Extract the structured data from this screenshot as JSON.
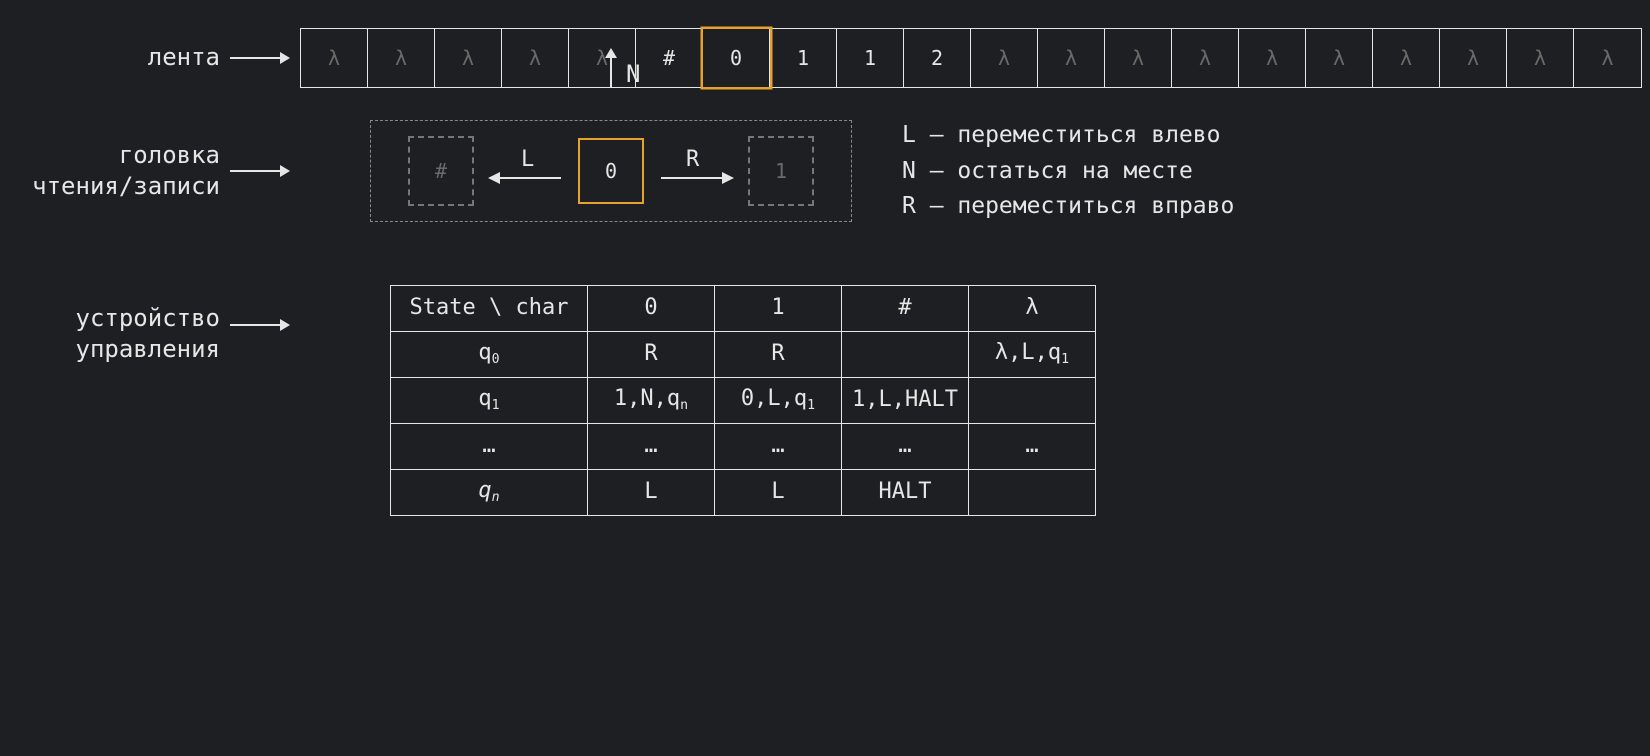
{
  "labels": {
    "tape": "лента",
    "head_line1": "головка",
    "head_line2": "чтения/записи",
    "control_line1": "устройство",
    "control_line2": "управления"
  },
  "tape_cells": [
    {
      "v": "λ",
      "dim": true
    },
    {
      "v": "λ",
      "dim": true
    },
    {
      "v": "λ",
      "dim": true
    },
    {
      "v": "λ",
      "dim": true
    },
    {
      "v": "λ",
      "dim": true
    },
    {
      "v": "#"
    },
    {
      "v": "0",
      "highlight": true
    },
    {
      "v": "1"
    },
    {
      "v": "1"
    },
    {
      "v": "2"
    },
    {
      "v": "λ",
      "dim": true
    },
    {
      "v": "λ",
      "dim": true
    },
    {
      "v": "λ",
      "dim": true
    },
    {
      "v": "λ",
      "dim": true
    },
    {
      "v": "λ",
      "dim": true
    },
    {
      "v": "λ",
      "dim": true
    },
    {
      "v": "λ",
      "dim": true
    },
    {
      "v": "λ",
      "dim": true
    },
    {
      "v": "λ",
      "dim": true
    },
    {
      "v": "λ",
      "dim": true
    }
  ],
  "head": {
    "left_ghost": "#",
    "current": "0",
    "right_ghost": "1",
    "dir_L": "L",
    "dir_N": "N",
    "dir_R": "R"
  },
  "legend": {
    "L": "L – переместиться влево",
    "N": "N – остаться на месте",
    "R": "R – переместиться вправо"
  },
  "table": {
    "header": [
      "State \\ char",
      "0",
      "1",
      "#",
      "λ"
    ],
    "rows": [
      {
        "state": "q",
        "state_sub": "0",
        "cells": [
          "R",
          "R",
          "",
          "λ,L,q"
        ],
        "cell_subs": [
          "",
          "",
          "",
          "1"
        ]
      },
      {
        "state": "q",
        "state_sub": "1",
        "cells": [
          "1,N,q",
          "0,L,q",
          "1,L,HALT",
          ""
        ],
        "cell_subs": [
          "n",
          "1",
          "",
          ""
        ]
      },
      {
        "state": "…",
        "state_sub": "",
        "cells": [
          "…",
          "…",
          "…",
          "…"
        ],
        "cell_subs": [
          "",
          "",
          "",
          ""
        ]
      },
      {
        "state": "q",
        "state_sub": "n",
        "italic": true,
        "cells": [
          "L",
          "L",
          "HALT",
          ""
        ],
        "cell_subs": [
          "",
          "",
          "",
          ""
        ]
      }
    ]
  }
}
